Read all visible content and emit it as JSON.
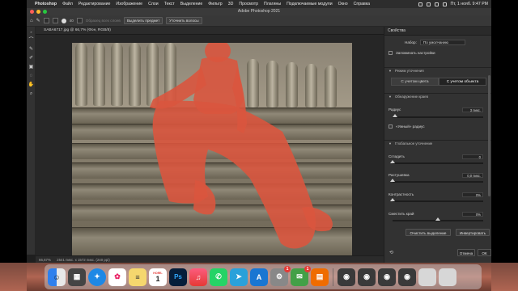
{
  "menubar": {
    "app_name": "Photoshop",
    "items": [
      "Файл",
      "Редактирование",
      "Изображение",
      "Слои",
      "Текст",
      "Выделение",
      "Фильтр",
      "3D",
      "Просмотр",
      "Плагины",
      "Подключаемые модули",
      "Окно",
      "Справка"
    ],
    "datetime": "Пт, 1 нояб.  9:47 PM"
  },
  "window": {
    "title": "Adobe Photoshop 2021"
  },
  "options_bar": {
    "size_value": "40",
    "sample_all_layers": "Образец всех слоев",
    "select_subject": "Выделить предмет",
    "refine_hair": "Уточнить волосы"
  },
  "document": {
    "tab_title": "SABA6717.jpg @ 66,7% (Фон, RGB/8)",
    "zoom": "66,67%",
    "status": "2541 пикс. x 1572 пикс. (240 ppi)"
  },
  "properties": {
    "tab": "Свойства",
    "preset_label": "Набор:",
    "preset_value": "По умолчанию",
    "remember_settings": "Запоминать настройки",
    "refine_mode": {
      "header": "Режим уточнения",
      "color_aware": "С учетом цвета",
      "object_aware": "С учетом объекта",
      "active": "object"
    },
    "edge_detection": {
      "header": "Обнаружение краев",
      "radius_label": "Радиус",
      "radius_value": "3 пикс.",
      "smart_radius": "«Умный» радиус",
      "radius_level": 0.03
    },
    "global_refinements": {
      "header": "Глобальное уточнение",
      "smooth_label": "Сгладить",
      "smooth_value": "0",
      "smooth_level": 0.0,
      "feather_label": "Растушевка",
      "feather_value": "0,0 пикс.",
      "feather_level": 0.0,
      "contrast_label": "Контрастность",
      "contrast_value": "0%",
      "contrast_level": 0.0,
      "shift_edge_label": "Сместить край",
      "shift_edge_value": "0%",
      "shift_edge_level": 0.5
    },
    "clear_selection": "Очистить выделение",
    "invert": "Инвертировать",
    "cancel": "Отмена",
    "ok": "ОК"
  },
  "dock": {
    "calendar_month": "НОЯБ.",
    "calendar_day": "1",
    "photoshop_label": "Ps",
    "badge_settings": "1",
    "badge_messages": "1"
  }
}
